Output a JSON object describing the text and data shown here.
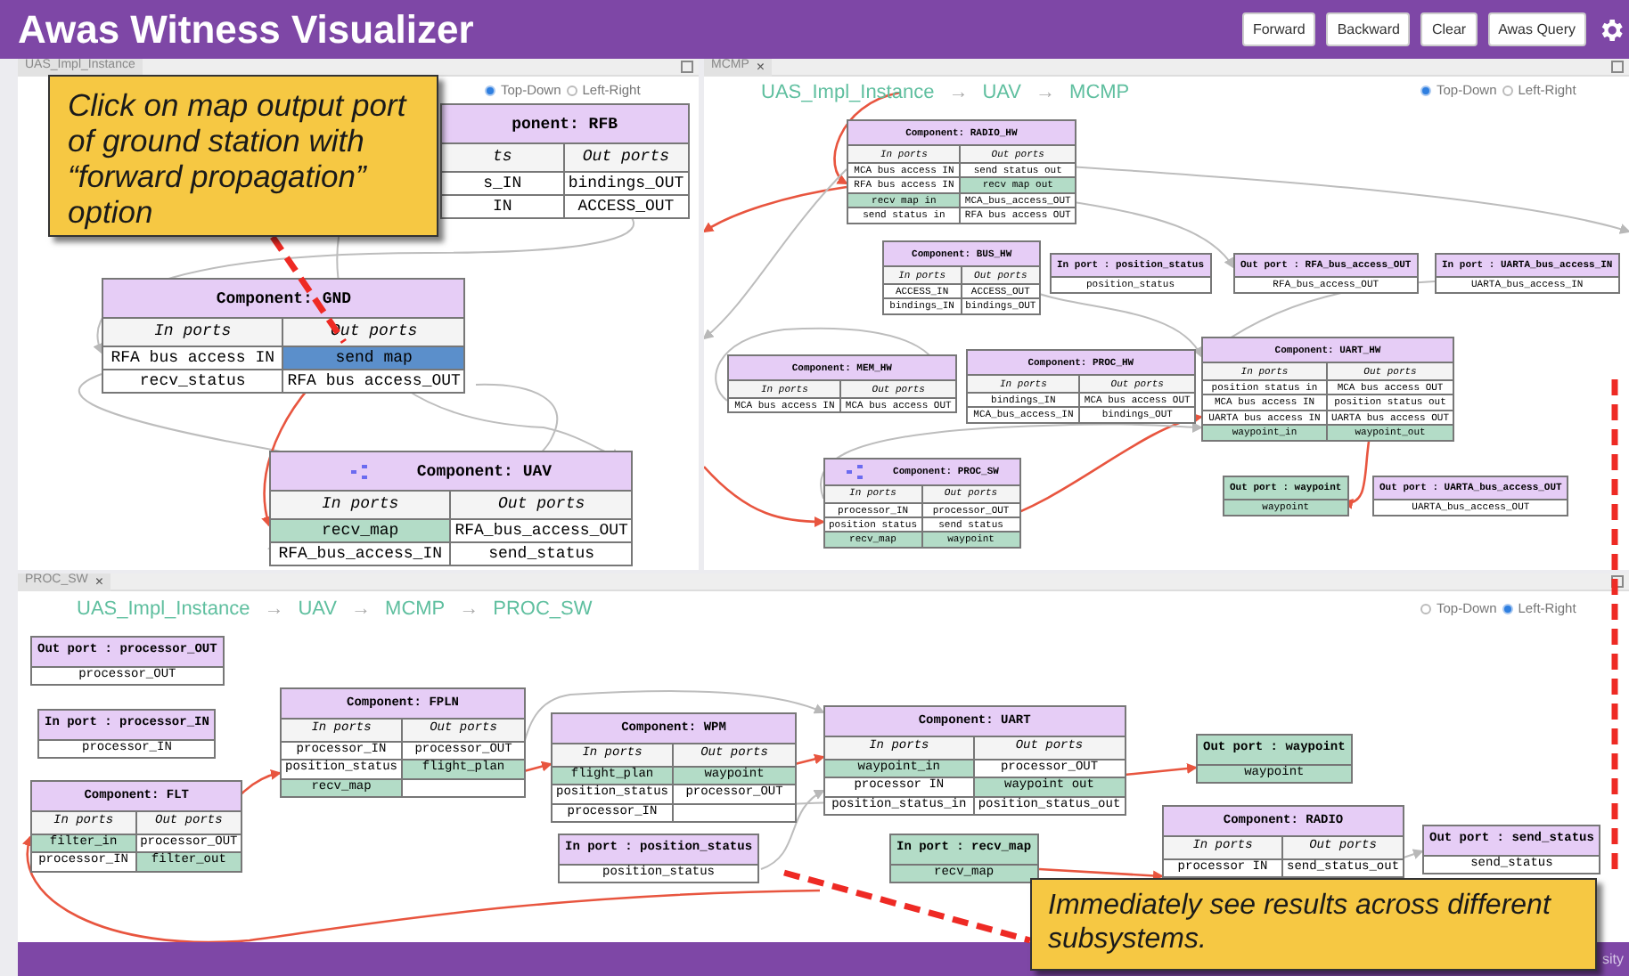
{
  "header": {
    "title": "Awas Witness Visualizer",
    "buttons": [
      "Forward",
      "Backward",
      "Clear",
      "Awas Query"
    ]
  },
  "panels": [
    {
      "tab": {
        "label": "UAS_Impl_Instance"
      },
      "layout_options": [
        {
          "label": "Top-Down",
          "selected": true
        },
        {
          "label": "Left-Right",
          "selected": false
        }
      ],
      "nodes": [
        {
          "kind": "component",
          "title": "ponent: RFB",
          "icon": false,
          "in_header": "ts",
          "out_header": "Out ports",
          "in_ports": [
            {
              "label": "s_IN",
              "highlighted": false,
              "selected": false
            },
            {
              "label": "IN",
              "highlighted": false,
              "selected": false
            }
          ],
          "out_ports": [
            {
              "label": "bindings_OUT",
              "highlighted": false,
              "selected": false
            },
            {
              "label": "ACCESS_OUT",
              "highlighted": false,
              "selected": false
            }
          ]
        },
        {
          "kind": "component",
          "title": "Component: GND",
          "icon": false,
          "in_header": "In ports",
          "out_header": "Out ports",
          "in_ports": [
            {
              "label": "RFA bus access IN",
              "highlighted": false,
              "selected": false
            },
            {
              "label": "recv_status",
              "highlighted": false,
              "selected": false
            }
          ],
          "out_ports": [
            {
              "label": "send map",
              "highlighted": false,
              "selected": true
            },
            {
              "label": "RFA bus access_OUT",
              "highlighted": false,
              "selected": false
            }
          ]
        },
        {
          "kind": "component",
          "title": "Component: UAV",
          "icon": true,
          "in_header": "In ports",
          "out_header": "Out ports",
          "in_ports": [
            {
              "label": "recv_map",
              "highlighted": true,
              "selected": false
            },
            {
              "label": "RFA_bus_access_IN",
              "highlighted": false,
              "selected": false
            }
          ],
          "out_ports": [
            {
              "label": "RFA_bus_access_OUT",
              "highlighted": false,
              "selected": false
            },
            {
              "label": "send_status",
              "highlighted": false,
              "selected": false
            }
          ]
        }
      ],
      "edges": [
        {
          "highlighted": false
        },
        {
          "highlighted": false
        },
        {
          "highlighted": false
        },
        {
          "highlighted": false
        },
        {
          "highlighted": true
        }
      ]
    },
    {
      "tab": {
        "label": "MCMP",
        "close": "×"
      },
      "breadcrumb": [
        {
          "kind": "link",
          "text": "UAS_Impl_Instance"
        },
        {
          "kind": "separator",
          "text": "→"
        },
        {
          "kind": "link",
          "text": "UAV"
        },
        {
          "kind": "separator",
          "text": "→"
        },
        {
          "kind": "link",
          "text": "MCMP"
        }
      ],
      "layout_options": [
        {
          "label": "Top-Down",
          "selected": true
        },
        {
          "label": "Left-Right",
          "selected": false
        }
      ],
      "nodes": [
        {
          "kind": "component",
          "title": "Component: RADIO_HW",
          "icon": false,
          "in_header": "In ports",
          "out_header": "Out ports",
          "in_ports": [
            {
              "label": "MCA bus access IN",
              "highlighted": false,
              "selected": false
            },
            {
              "label": "RFA bus access IN",
              "highlighted": false,
              "selected": false
            },
            {
              "label": "recv map in",
              "highlighted": true,
              "selected": false
            },
            {
              "label": "send status in",
              "highlighted": false,
              "selected": false
            }
          ],
          "out_ports": [
            {
              "label": "send status out",
              "highlighted": false,
              "selected": false
            },
            {
              "label": "recv map out",
              "highlighted": true,
              "selected": false
            },
            {
              "label": "MCA_bus_access_OUT",
              "highlighted": false,
              "selected": false
            },
            {
              "label": "RFA bus access OUT",
              "highlighted": false,
              "selected": false
            }
          ]
        },
        {
          "kind": "component",
          "title": "Component: BUS_HW",
          "icon": false,
          "in_header": "In ports",
          "out_header": "Out ports",
          "in_ports": [
            {
              "label": "ACCESS_IN",
              "highlighted": false,
              "selected": false
            },
            {
              "label": "bindings_IN",
              "highlighted": false,
              "selected": false
            }
          ],
          "out_ports": [
            {
              "label": "ACCESS_OUT",
              "highlighted": false,
              "selected": false
            },
            {
              "label": "bindings_OUT",
              "highlighted": false,
              "selected": false
            }
          ]
        },
        {
          "kind": "port",
          "title": "In port : position_status",
          "port": "position_status",
          "highlighted": false
        },
        {
          "kind": "port",
          "title": "Out port : RFA_bus_access_OUT",
          "port": "RFA_bus_access_OUT",
          "highlighted": false
        },
        {
          "kind": "port",
          "title": "In port : UARTA_bus_access_IN",
          "port": "UARTA_bus_access_IN",
          "highlighted": false
        },
        {
          "kind": "component",
          "title": "Component: MEM_HW",
          "icon": false,
          "in_header": "In ports",
          "out_header": "Out ports",
          "in_ports": [
            {
              "label": "MCA bus access IN",
              "highlighted": false,
              "selected": false
            }
          ],
          "out_ports": [
            {
              "label": "MCA bus access OUT",
              "highlighted": false,
              "selected": false
            }
          ]
        },
        {
          "kind": "component",
          "title": "Component: PROC_HW",
          "icon": false,
          "in_header": "In ports",
          "out_header": "Out ports",
          "in_ports": [
            {
              "label": "bindings_IN",
              "highlighted": false,
              "selected": false
            },
            {
              "label": "MCA_bus_access_IN",
              "highlighted": false,
              "selected": false
            }
          ],
          "out_ports": [
            {
              "label": "MCA bus access OUT",
              "highlighted": false,
              "selected": false
            },
            {
              "label": "bindings_OUT",
              "highlighted": false,
              "selected": false
            }
          ]
        },
        {
          "kind": "component",
          "title": "Component: UART_HW",
          "icon": false,
          "in_header": "In ports",
          "out_header": "Out ports",
          "in_ports": [
            {
              "label": "position status in",
              "highlighted": false,
              "selected": false
            },
            {
              "label": "MCA bus access IN",
              "highlighted": false,
              "selected": false
            },
            {
              "label": "UARTA bus access IN",
              "highlighted": false,
              "selected": false
            },
            {
              "label": "waypoint_in",
              "highlighted": true,
              "selected": false
            }
          ],
          "out_ports": [
            {
              "label": "MCA bus access OUT",
              "highlighted": false,
              "selected": false
            },
            {
              "label": "position status out",
              "highlighted": false,
              "selected": false
            },
            {
              "label": "UARTA bus access OUT",
              "highlighted": false,
              "selected": false
            },
            {
              "label": "waypoint_out",
              "highlighted": true,
              "selected": false
            }
          ]
        },
        {
          "kind": "component",
          "title": "Component: PROC_SW",
          "icon": true,
          "in_header": "In ports",
          "out_header": "Out ports",
          "in_ports": [
            {
              "label": "processor_IN",
              "highlighted": false,
              "selected": false
            },
            {
              "label": "position status",
              "highlighted": false,
              "selected": false
            },
            {
              "label": "recv_map",
              "highlighted": true,
              "selected": false
            }
          ],
          "out_ports": [
            {
              "label": "processor_OUT",
              "highlighted": false,
              "selected": false
            },
            {
              "label": "send status",
              "highlighted": false,
              "selected": false
            },
            {
              "label": "waypoint",
              "highlighted": true,
              "selected": false
            }
          ]
        },
        {
          "kind": "port",
          "title": "Out port : waypoint",
          "port": "waypoint",
          "highlighted": true
        },
        {
          "kind": "port",
          "title": "Out port : UARTA_bus_access_OUT",
          "port": "UARTA_bus_access_OUT",
          "highlighted": false
        }
      ],
      "edges": [
        {
          "highlighted": true
        },
        {
          "highlighted": true
        },
        {
          "highlighted": true
        },
        {
          "highlighted": true
        },
        {
          "highlighted": true
        },
        {
          "highlighted": false
        },
        {
          "highlighted": false
        },
        {
          "highlighted": false
        },
        {
          "highlighted": false
        },
        {
          "highlighted": false
        },
        {
          "highlighted": false
        },
        {
          "highlighted": false
        }
      ]
    },
    {
      "tab": {
        "label": "PROC_SW",
        "close": "×"
      },
      "breadcrumb": [
        {
          "kind": "link",
          "text": "UAS_Impl_Instance"
        },
        {
          "kind": "separator",
          "text": "→"
        },
        {
          "kind": "link",
          "text": "UAV"
        },
        {
          "kind": "separator",
          "text": "→"
        },
        {
          "kind": "link",
          "text": "MCMP"
        },
        {
          "kind": "separator",
          "text": "→"
        },
        {
          "kind": "link",
          "text": "PROC_SW"
        }
      ],
      "layout_options": [
        {
          "label": "Top-Down",
          "selected": false
        },
        {
          "label": "Left-Right",
          "selected": true
        }
      ],
      "nodes": [
        {
          "kind": "port",
          "title": "Out port : processor_OUT",
          "port": "processor_OUT",
          "highlighted": false
        },
        {
          "kind": "port",
          "title": "In port : processor_IN",
          "port": "processor_IN",
          "highlighted": false
        },
        {
          "kind": "component",
          "title": "Component: FLT",
          "icon": false,
          "in_header": "In ports",
          "out_header": "Out ports",
          "in_ports": [
            {
              "label": "filter_in",
              "highlighted": true,
              "selected": false
            },
            {
              "label": "processor_IN",
              "highlighted": false,
              "selected": false
            }
          ],
          "out_ports": [
            {
              "label": "processor_OUT",
              "highlighted": false,
              "selected": false
            },
            {
              "label": "filter_out",
              "highlighted": true,
              "selected": false
            }
          ]
        },
        {
          "kind": "component",
          "title": "Component: FPLN",
          "icon": false,
          "in_header": "In ports",
          "out_header": "Out ports",
          "in_ports": [
            {
              "label": "processor_IN",
              "highlighted": false,
              "selected": false
            },
            {
              "label": "position_status",
              "highlighted": false,
              "selected": false
            },
            {
              "label": "recv_map",
              "highlighted": true,
              "selected": false
            }
          ],
          "out_ports": [
            {
              "label": "processor_OUT",
              "highlighted": false,
              "selected": false
            },
            {
              "label": "flight_plan",
              "highlighted": true,
              "selected": false
            }
          ]
        },
        {
          "kind": "component",
          "title": "Component: WPM",
          "icon": false,
          "in_header": "In ports",
          "out_header": "Out ports",
          "in_ports": [
            {
              "label": "flight_plan",
              "highlighted": true,
              "selected": false
            },
            {
              "label": "position_status",
              "highlighted": false,
              "selected": false
            },
            {
              "label": "processor_IN",
              "highlighted": false,
              "selected": false
            }
          ],
          "out_ports": [
            {
              "label": "waypoint",
              "highlighted": true,
              "selected": false
            },
            {
              "label": "processor_OUT",
              "highlighted": false,
              "selected": false
            }
          ]
        },
        {
          "kind": "port",
          "title": "In port : position_status",
          "port": "position_status",
          "highlighted": false
        },
        {
          "kind": "component",
          "title": "Component: UART",
          "icon": false,
          "in_header": "In ports",
          "out_header": "Out ports",
          "in_ports": [
            {
              "label": "waypoint_in",
              "highlighted": true,
              "selected": false
            },
            {
              "label": "processor IN",
              "highlighted": false,
              "selected": false
            },
            {
              "label": "position_status_in",
              "highlighted": false,
              "selected": false
            }
          ],
          "out_ports": [
            {
              "label": "processor_OUT",
              "highlighted": false,
              "selected": false
            },
            {
              "label": "waypoint out",
              "highlighted": true,
              "selected": false
            },
            {
              "label": "position_status_out",
              "highlighted": false,
              "selected": false
            }
          ]
        },
        {
          "kind": "port",
          "title": "Out port : waypoint",
          "port": "waypoint",
          "highlighted": true
        },
        {
          "kind": "port",
          "title": "In port : recv_map",
          "port": "recv_map",
          "highlighted": true
        },
        {
          "kind": "component",
          "title": "Component: RADIO",
          "icon": false,
          "in_header": "In ports",
          "out_header": "Out ports",
          "in_ports": [
            {
              "label": "processor IN",
              "highlighted": false,
              "selected": false
            }
          ],
          "out_ports": [
            {
              "label": "send_status_out",
              "highlighted": false,
              "selected": false
            }
          ]
        },
        {
          "kind": "port",
          "title": "Out port : send_status",
          "port": "send_status",
          "highlighted": false
        }
      ],
      "edges": [
        {
          "highlighted": true
        },
        {
          "highlighted": true
        },
        {
          "highlighted": true
        },
        {
          "highlighted": true
        },
        {
          "highlighted": true
        },
        {
          "highlighted": true
        },
        {
          "highlighted": false
        },
        {
          "highlighted": false
        },
        {
          "highlighted": false
        },
        {
          "highlighted": false
        }
      ]
    }
  ],
  "callouts": [
    {
      "text": "Click on map output port of ground station with “forward propagation” option"
    },
    {
      "text": "Immediately see results across different subsystems."
    }
  ],
  "footer": {
    "text": "sity"
  }
}
